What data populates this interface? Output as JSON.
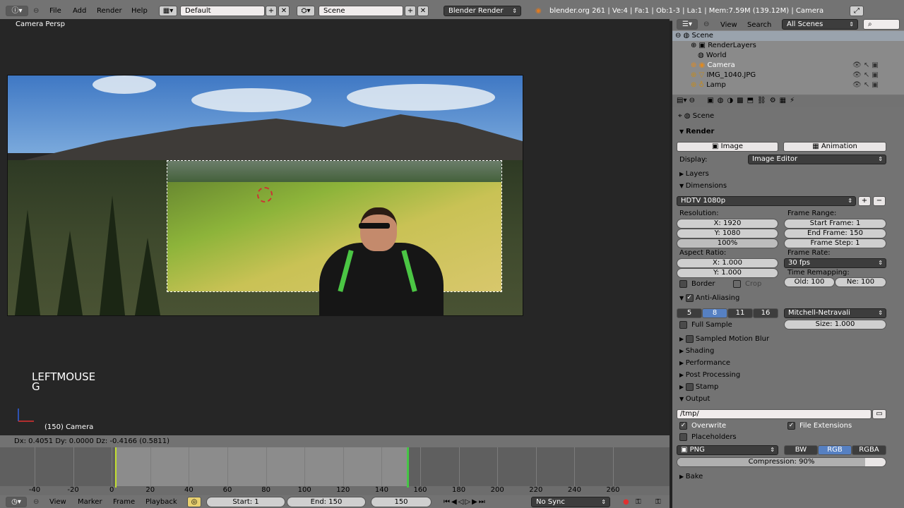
{
  "topbar": {
    "menus": [
      "File",
      "Add",
      "Render",
      "Help"
    ],
    "layout": "Default",
    "scene": "Scene",
    "engine": "Blender Render",
    "stats": "blender.org 261 | Ve:4 | Fa:1 | Ob:1-3 | La:1 | Mem:7.59M (139.12M) | Camera"
  },
  "viewport": {
    "title": "Camera Persp",
    "key_line1": "LEFTMOUSE",
    "key_line2": "G",
    "object": "(150) Camera",
    "status": "Dx: 0.4051   Dy: 0.0000   Dz: -0.4166 (0.5811)"
  },
  "timeline": {
    "ticks": [
      "-40",
      "-20",
      "0",
      "20",
      "40",
      "60",
      "80",
      "100",
      "120",
      "140",
      "160",
      "180",
      "200",
      "220",
      "240",
      "260"
    ],
    "menus": [
      "View",
      "Marker",
      "Frame",
      "Playback"
    ],
    "start": "Start: 1",
    "end": "End: 150",
    "current": "150",
    "sync": "No Sync"
  },
  "outliner": {
    "menus": [
      "View",
      "Search"
    ],
    "filter": "All Scenes",
    "items": [
      "Scene",
      "RenderLayers",
      "World",
      "Camera",
      "IMG_1040.JPG",
      "Lamp"
    ]
  },
  "props": {
    "breadcrumb": "Scene",
    "render": {
      "title": "Render",
      "image": "Image",
      "animation": "Animation",
      "display_label": "Display:",
      "display": "Image Editor"
    },
    "layers": "Layers",
    "dimensions": {
      "title": "Dimensions",
      "preset": "HDTV 1080p",
      "resolution_label": "Resolution:",
      "res_x": "X: 1920",
      "res_y": "Y: 1080",
      "res_pct": "100%",
      "frame_range_label": "Frame Range:",
      "start": "Start Frame: 1",
      "end": "End Frame: 150",
      "step": "Frame Step: 1",
      "aspect_label": "Aspect Ratio:",
      "asp_x": "X: 1.000",
      "asp_y": "Y: 1.000",
      "frame_rate_label": "Frame Rate:",
      "fps": "30 fps",
      "remap_label": "Time Remapping:",
      "old": "Old: 100",
      "new": "Ne: 100",
      "border": "Border",
      "crop": "Crop"
    },
    "aa": {
      "title": "Anti-Aliasing",
      "samples": [
        "5",
        "8",
        "11",
        "16"
      ],
      "filter": "Mitchell-Netravali",
      "full_sample": "Full Sample",
      "size": "Size: 1.000"
    },
    "sections": [
      "Sampled Motion Blur",
      "Shading",
      "Performance",
      "Post Processing",
      "Stamp"
    ],
    "output": {
      "title": "Output",
      "path": "/tmp/",
      "overwrite": "Overwrite",
      "file_ext": "File Extensions",
      "placeholders": "Placeholders",
      "format": "PNG",
      "bw": "BW",
      "rgb": "RGB",
      "rgba": "RGBA",
      "compression": "Compression: 90%",
      "compression_value": 0.9
    },
    "bake": "Bake"
  },
  "colors": {
    "accent": "#5680c2",
    "current_frame": "#46c646",
    "start_frame": "#c3e030"
  }
}
